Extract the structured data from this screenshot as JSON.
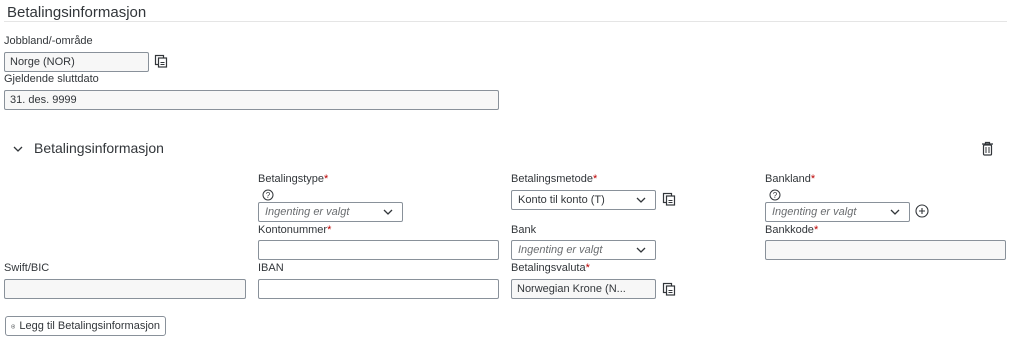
{
  "section": {
    "title": "Betalingsinformasjon"
  },
  "job_country": {
    "label": "Jobbland/-område",
    "value": "Norge (NOR)"
  },
  "end_date": {
    "label": "Gjeldende sluttdato",
    "value": "31. des. 9999"
  },
  "payment": {
    "title": "Betalingsinformasjon",
    "payment_type": {
      "label": "Betalingstype",
      "placeholder": "Ingenting er valgt"
    },
    "payment_method": {
      "label": "Betalingsmetode",
      "value": "Konto til konto (T)"
    },
    "bank_country": {
      "label": "Bankland",
      "placeholder": "Ingenting er valgt"
    },
    "account_number": {
      "label": "Kontonummer",
      "value": ""
    },
    "bank": {
      "label": "Bank",
      "placeholder": "Ingenting er valgt"
    },
    "bank_code": {
      "label": "Bankkode",
      "value": ""
    },
    "swift": {
      "label": "Swift/BIC",
      "value": ""
    },
    "iban": {
      "label": "IBAN",
      "value": ""
    },
    "currency": {
      "label": "Betalingsvaluta",
      "value": "Norwegian Krone (N..."
    },
    "required_mark": "*"
  },
  "add_button": {
    "label": "Legg til Betalingsinformasjon"
  },
  "icons": {
    "copy": "copy-icon",
    "help": "help-circle-icon",
    "delete": "trash-icon",
    "add": "add-circle-icon",
    "chevron": "chevron-down-icon"
  }
}
